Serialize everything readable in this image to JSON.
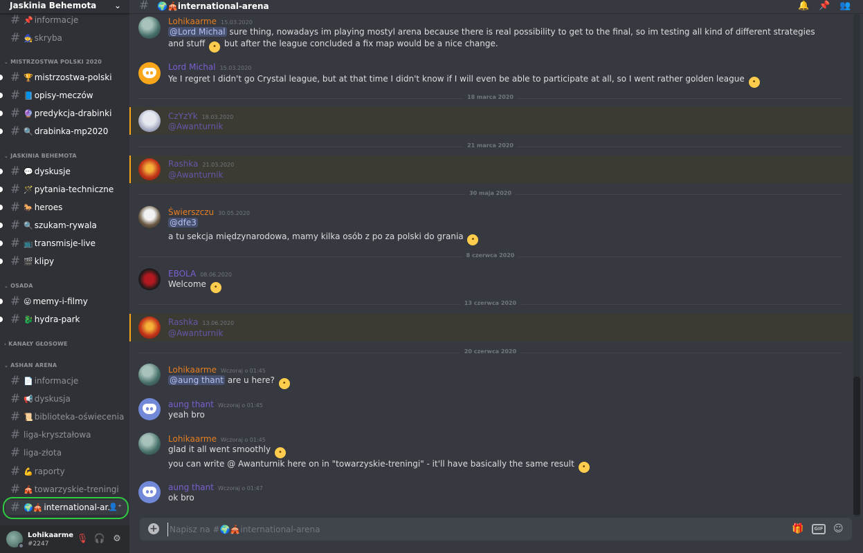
{
  "server": {
    "name": "Jaskinia Behemota"
  },
  "channel_header": {
    "name": "🌍🎪international-arena"
  },
  "sidebar": {
    "channels_top": [
      {
        "emoji": "📌",
        "name": "informacje"
      },
      {
        "emoji": "🧙",
        "name": "skryba"
      }
    ],
    "categories": [
      {
        "name": "MISTRZOSTWA POLSKI 2020",
        "channels": [
          {
            "emoji": "🏆",
            "name": "mistrzostwa-polski"
          },
          {
            "emoji": "📘",
            "name": "opisy-meczów"
          },
          {
            "emoji": "🔮",
            "name": "predykcja-drabinki"
          },
          {
            "emoji": "🔍",
            "name": "drabinka-mp2020"
          }
        ]
      },
      {
        "name": "JASKINIA BEHEMOTA",
        "channels": [
          {
            "emoji": "💬",
            "name": "dyskusje"
          },
          {
            "emoji": "🪄",
            "name": "pytania-techniczne"
          },
          {
            "emoji": "🐎",
            "name": "heroes"
          },
          {
            "emoji": "🔍",
            "name": "szukam-rywala"
          },
          {
            "emoji": "📺",
            "name": "transmisje-live"
          },
          {
            "emoji": "🎬",
            "name": "klipy"
          }
        ]
      },
      {
        "name": "OSADA",
        "channels": [
          {
            "emoji": "😛",
            "name": "memy-i-filmy"
          },
          {
            "emoji": "🐉",
            "name": "hydra-park"
          }
        ]
      },
      {
        "name": "KANAŁY GŁOSOWE",
        "channels": []
      },
      {
        "name": "ASHAN ARENA",
        "channels": [
          {
            "emoji": "📄",
            "name": "informacje"
          },
          {
            "emoji": "📢",
            "name": "dyskusja"
          },
          {
            "emoji": "📜",
            "name": "biblioteka-oświecenia"
          },
          {
            "emoji": "",
            "name": "liga-kryształowa"
          },
          {
            "emoji": "",
            "name": "liga-złota"
          },
          {
            "emoji": "💪",
            "name": "raporty"
          },
          {
            "emoji": "🎪",
            "name": "towarzyskie-treningi"
          },
          {
            "emoji": "🌍🎪",
            "name": "international-ar..."
          }
        ]
      }
    ]
  },
  "user": {
    "name": "Lohikaarme",
    "tag": "#2247"
  },
  "messages": [
    {
      "author": "Lohikaarme",
      "time": "15.03.2020",
      "mention": "@Lord Michal",
      "text": "sure thing, nowadays im playing mostyl arena because there is real possibility to get to the final, so im testing all kind of different strategies and stuff",
      "text2": "but after the league concluded a fix map would be a nice change."
    },
    {
      "author": "Lord Michal",
      "time": "15.03.2020",
      "text": "Ye I regret I didn't go Crystal league, but at that time I didn't know if I will even be able to participate at all, so I went rather golden league"
    },
    {
      "divider": "18 marca 2020"
    },
    {
      "author": "CzYzYk",
      "time": "18.03.2020",
      "mention": "@Awanturnik"
    },
    {
      "divider": "21 marca 2020"
    },
    {
      "author": "Rashka",
      "time": "21.03.2020",
      "mention": "@Awanturnik"
    },
    {
      "divider": "30 maja 2020"
    },
    {
      "author": "Świerszczu",
      "time": "30.05.2020",
      "mention": "@dfe3",
      "text": "a tu sekcja międzynarodowa, mamy kilka osób z po za polski do grania"
    },
    {
      "divider": "8 czerwca 2020"
    },
    {
      "author": "EBOLA",
      "time": "08.06.2020",
      "text": "Welcome"
    },
    {
      "divider": "13 czerwca 2020"
    },
    {
      "author": "Rashka",
      "time": "13.06.2020",
      "mention": "@Awanturnik"
    },
    {
      "divider": "20 czerwca 2020"
    },
    {
      "author": "Lohikaarme",
      "time": "Wczoraj o 01:45",
      "mention": "@aung thant",
      "text": "are u here?"
    },
    {
      "author": "aung thant",
      "time": "Wczoraj o 01:45",
      "text": "yeah bro"
    },
    {
      "author": "Lohikaarme",
      "time": "Wczoraj o 01:45",
      "text": "glad it all went smoothly",
      "text2": "you can write @ Awanturnik here on in \"towarzyskie-treningi\" - it'll have basically the same result"
    },
    {
      "author": "aung thant",
      "time": "Wczoraj o 01:47",
      "text": "ok bro"
    }
  ],
  "composer": {
    "placeholder": "Napisz na #🌍🎪international-arena"
  },
  "colors": {
    "orange_author": "#e67e22",
    "purple_author": "#7a5fd0",
    "mention_bar": "#faa81a",
    "active_ring": "#2ecc40"
  },
  "icons": {
    "header": [
      "bell-icon",
      "pin-icon",
      "members-icon"
    ],
    "composer": [
      "plus-icon",
      "gift-icon",
      "gif-icon",
      "emoji-icon"
    ],
    "user_panel": [
      "mute-mic-icon",
      "headphones-icon",
      "gear-icon"
    ]
  }
}
